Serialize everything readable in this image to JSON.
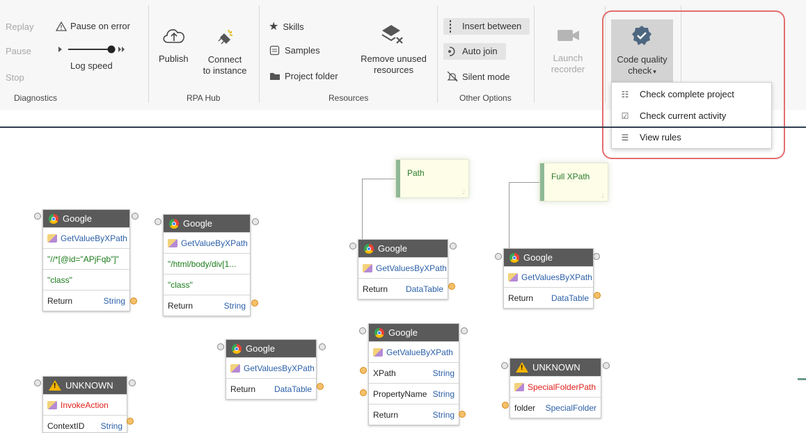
{
  "ribbon": {
    "diagnostics": {
      "replay": "Replay",
      "pause": "Pause",
      "stop": "Stop",
      "pause_on_error": "Pause on error",
      "log_speed": "Log speed",
      "group_label": "Diagnostics"
    },
    "rpa_hub": {
      "publish": "Publish",
      "connect_line1": "Connect",
      "connect_line2": "to instance",
      "group_label": "RPA Hub"
    },
    "resources": {
      "skills": "Skills",
      "samples": "Samples",
      "project_folder": "Project folder",
      "remove_line1": "Remove unused",
      "remove_line2": "resources",
      "group_label": "Resources"
    },
    "other_options": {
      "insert_between": "Insert between",
      "auto_join": "Auto join",
      "silent_mode": "Silent mode",
      "group_label": "Other Options"
    },
    "launch_recorder_line1": "Launch",
    "launch_recorder_line2": "recorder",
    "code_quality_line1": "Code quality",
    "code_quality_line2": "check"
  },
  "dropdown": {
    "items": [
      {
        "label": "Check complete project",
        "icon": "clipboard-check-icon"
      },
      {
        "label": "Check current activity",
        "icon": "activity-check-icon"
      },
      {
        "label": "View rules",
        "icon": "rules-list-icon"
      }
    ]
  },
  "notes": [
    {
      "text": "Path"
    },
    {
      "text": "Full XPath"
    }
  ],
  "nodes": [
    {
      "header": "Google",
      "activity": "GetValueByXPath",
      "arg1": "\"//*[@id=\"APjFqb\"]\"",
      "arg2": "\"class\"",
      "ret_label": "Return",
      "ret_type": "String"
    },
    {
      "header": "Google",
      "activity": "GetValueByXPath",
      "arg1": "\"/html/body/div[1...",
      "arg2": "\"class\"",
      "ret_label": "Return",
      "ret_type": "String"
    },
    {
      "header": "Google",
      "activity": "GetValuesByXPath",
      "ret_label": "Return",
      "ret_type": "DataTable"
    },
    {
      "header": "Google",
      "activity": "GetValuesByXPath",
      "ret_label": "Return",
      "ret_type": "DataTable"
    },
    {
      "header": "Google",
      "activity": "GetValuesByXPath",
      "ret_label": "Return",
      "ret_type": "DataTable"
    },
    {
      "header": "Google",
      "activity": "GetValueByXPath",
      "p1_label": "XPath",
      "p1_type": "String",
      "p2_label": "PropertyName",
      "p2_type": "String",
      "ret_label": "Return",
      "ret_type": "String"
    },
    {
      "header": "UNKNOWN",
      "activity": "SpecialFolderPath",
      "p1_label": "folder",
      "p1_type": "SpecialFolder"
    },
    {
      "header": "UNKNOWN",
      "activity": "InvokeAction",
      "p1_label": "ContextID",
      "p1_type": "String"
    }
  ],
  "colors": {
    "highlight_box": "#e46d6d",
    "node_header": "#5a5a5a",
    "error_text": "#e0201b",
    "type_text": "#2b5fa8"
  }
}
